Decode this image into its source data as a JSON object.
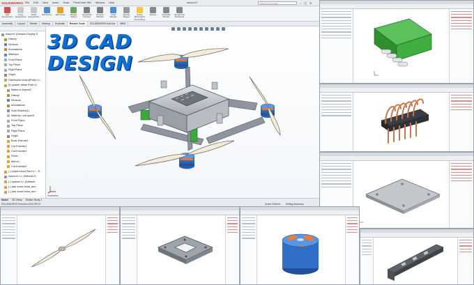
{
  "app": {
    "logo": "SOLIDWORKS",
    "menus": [
      "File",
      "Edit",
      "View",
      "Insert",
      "Tools",
      "PhotoView 360",
      "Window",
      "Help"
    ],
    "doc_title": "Assem2 *",
    "search_placeholder": "Search Commands",
    "window_buttons": [
      "–",
      "▢",
      "✕"
    ]
  },
  "ribbon": [
    {
      "label": "Edit Appearance",
      "color": "#d05050"
    },
    {
      "label": "Copy Appearance",
      "color": "#c8c8c8"
    },
    {
      "label": "Paste Appearance",
      "color": "#c8c8c8"
    },
    {
      "label": "Edit Scene",
      "color": "#4d8fd6"
    },
    {
      "label": "Edit Decal",
      "color": "#e0a030"
    },
    {
      "label": "Display States",
      "color": "#6aa84f"
    },
    {
      "label": "Integrated Preview",
      "color": "#7f7f7f"
    },
    {
      "label": "Preview Window",
      "color": "#7f7f7f"
    },
    {
      "label": "Final Render",
      "color": "#4d8fd6"
    },
    {
      "label": "Render Region",
      "color": "#999999"
    },
    {
      "label": "Scene Illumination Proof Sheet",
      "color": "#f2c744"
    },
    {
      "label": "Options",
      "color": "#888888"
    },
    {
      "label": "Schedule Render",
      "color": "#888888"
    },
    {
      "label": "Recall Last Rendered",
      "color": "#888888"
    }
  ],
  "command_tabs": [
    "Assembly",
    "Layout",
    "Sketch",
    "Markup",
    "Evaluate",
    "Render Tools",
    "SOLIDWORKS Add-Ins",
    "MBD"
  ],
  "active_command_tab": "Render Tools",
  "tree": [
    {
      "label": "Assem2 (Default<Display S",
      "indent": 0,
      "color": "#8a99ad"
    },
    {
      "label": "History",
      "indent": 1,
      "color": "#b8893a"
    },
    {
      "label": "Sensors",
      "indent": 1,
      "color": "#5b82c6"
    },
    {
      "label": "Annotations",
      "indent": 1,
      "color": "#b8893a"
    },
    {
      "label": "Markups",
      "indent": 1,
      "color": "#5b82c6"
    },
    {
      "label": "Front Plane",
      "indent": 1,
      "color": "#9aa8b8"
    },
    {
      "label": "Top Plane",
      "indent": 1,
      "color": "#9aa8b8"
    },
    {
      "label": "Right Plane",
      "indent": 1,
      "color": "#9aa8b8"
    },
    {
      "label": "Origin",
      "indent": 1,
      "color": "#888888"
    },
    {
      "label": "Distribution board(Part)<1>",
      "indent": 1,
      "color": "#d0a04a"
    },
    {
      "label": "(f) quarter blade Part<1> ",
      "indent": 1,
      "color": "#d0a04a"
    },
    {
      "label": "Mates in Assem2",
      "indent": 2,
      "color": "#8a99ad"
    },
    {
      "label": "History",
      "indent": 2,
      "color": "#b8893a"
    },
    {
      "label": "Sensors",
      "indent": 2,
      "color": "#5b82c6"
    },
    {
      "label": "Annotations",
      "indent": 2,
      "color": "#b8893a"
    },
    {
      "label": "Solid Bodies(1)",
      "indent": 2,
      "color": "#7f8ea3"
    },
    {
      "label": "Material <not specif",
      "indent": 2,
      "color": "#b9b9b9"
    },
    {
      "label": "Front Plane",
      "indent": 2,
      "color": "#9aa8b8"
    },
    {
      "label": "Top Plane",
      "indent": 2,
      "color": "#9aa8b8"
    },
    {
      "label": "Right Plane",
      "indent": 2,
      "color": "#9aa8b8"
    },
    {
      "label": "Origin",
      "indent": 2,
      "color": "#888888"
    },
    {
      "label": "Boss-Extrude1",
      "indent": 2,
      "color": "#e0a030"
    },
    {
      "label": "Cut-Extrude1",
      "indent": 2,
      "color": "#e0a030"
    },
    {
      "label": "Cut-Extrude2",
      "indent": 2,
      "color": "#e0a030"
    },
    {
      "label": "Fillet1",
      "indent": 2,
      "color": "#e0a030"
    },
    {
      "label": "Mirror1",
      "indent": 2,
      "color": "#e0a030"
    },
    {
      "label": "Cut-Extrude4",
      "indent": 2,
      "color": "#e0a030"
    },
    {
      "label": "(-) Upper bead Part<1> - D",
      "indent": 1,
      "color": "#d0a04a"
    },
    {
      "label": "Assem1<1> (Default<D",
      "indent": 1,
      "color": "#8a99ad"
    },
    {
      "label": "(-) spacer<1> (Default<",
      "indent": 1,
      "color": "#d0a04a"
    },
    {
      "label": "(-) pan cross head_am<",
      "indent": 1,
      "color": "#d0a04a"
    },
    {
      "label": "(-) pan cross head_am<",
      "indent": 1,
      "color": "#d0a04a"
    }
  ],
  "headline": {
    "line1": "3D CAD",
    "line2": "DESIGN"
  },
  "triad_label": "*Isometric",
  "bottom_tabs": [
    "Model",
    "3D Views",
    "Motion Study 1"
  ],
  "active_bottom_tab": "Model",
  "status": {
    "left": "SOLIDWORKS Premium 2020 SP0.0",
    "mid": "Under Defined",
    "right": "Editing Assembly"
  },
  "colors": {
    "accent_blue": "#0e6fd7",
    "frame_grey": "#9aa3ad",
    "motor_blue": "#2f6fc7",
    "connector_green": "#3aa83a",
    "copper": "#c8774a"
  }
}
